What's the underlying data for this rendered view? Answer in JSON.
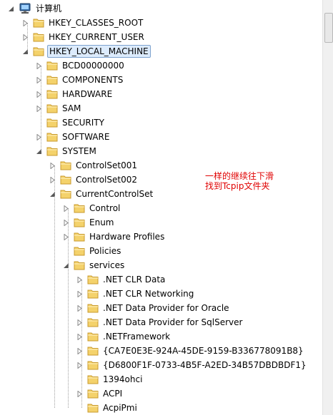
{
  "root": {
    "label": "计算机",
    "icon": "computer-icon"
  },
  "nodes": [
    {
      "label": "HKEY_CLASSES_ROOT",
      "level": 1,
      "expander": "collapsed"
    },
    {
      "label": "HKEY_CURRENT_USER",
      "level": 1,
      "expander": "collapsed"
    },
    {
      "label": "HKEY_LOCAL_MACHINE",
      "level": 1,
      "expander": "expanded",
      "selected": true
    },
    {
      "label": "BCD00000000",
      "level": 2,
      "expander": "collapsed"
    },
    {
      "label": "COMPONENTS",
      "level": 2,
      "expander": "collapsed"
    },
    {
      "label": "HARDWARE",
      "level": 2,
      "expander": "collapsed"
    },
    {
      "label": "SAM",
      "level": 2,
      "expander": "collapsed"
    },
    {
      "label": "SECURITY",
      "level": 2,
      "expander": "none"
    },
    {
      "label": "SOFTWARE",
      "level": 2,
      "expander": "collapsed"
    },
    {
      "label": "SYSTEM",
      "level": 2,
      "expander": "expanded"
    },
    {
      "label": "ControlSet001",
      "level": 3,
      "expander": "collapsed"
    },
    {
      "label": "ControlSet002",
      "level": 3,
      "expander": "collapsed"
    },
    {
      "label": "CurrentControlSet",
      "level": 3,
      "expander": "expanded"
    },
    {
      "label": "Control",
      "level": 4,
      "expander": "collapsed"
    },
    {
      "label": "Enum",
      "level": 4,
      "expander": "collapsed"
    },
    {
      "label": "Hardware Profiles",
      "level": 4,
      "expander": "collapsed"
    },
    {
      "label": "Policies",
      "level": 4,
      "expander": "none"
    },
    {
      "label": "services",
      "level": 4,
      "expander": "expanded"
    },
    {
      "label": ".NET CLR Data",
      "level": 5,
      "expander": "collapsed"
    },
    {
      "label": ".NET CLR Networking",
      "level": 5,
      "expander": "collapsed"
    },
    {
      "label": ".NET Data Provider for Oracle",
      "level": 5,
      "expander": "collapsed"
    },
    {
      "label": ".NET Data Provider for SqlServer",
      "level": 5,
      "expander": "collapsed"
    },
    {
      "label": ".NETFramework",
      "level": 5,
      "expander": "collapsed"
    },
    {
      "label": "{CA7E0E3E-924A-45DE-9159-B336778091B8}",
      "level": 5,
      "expander": "collapsed"
    },
    {
      "label": "{D6800F1F-0733-4B5F-A2ED-34B57DBDBDF1}",
      "level": 5,
      "expander": "collapsed"
    },
    {
      "label": "1394ohci",
      "level": 5,
      "expander": "none"
    },
    {
      "label": "ACPI",
      "level": 5,
      "expander": "collapsed"
    },
    {
      "label": "AcpiPmi",
      "level": 5,
      "expander": "none"
    }
  ],
  "annotation": {
    "line1": "一样的继续往下滑",
    "line2": "找到Tcpip文件夹",
    "color": "#e00000"
  },
  "colors": {
    "folder_fill": "#f4d26b",
    "folder_edge": "#c89a2c",
    "selection": "#dcebfc"
  }
}
